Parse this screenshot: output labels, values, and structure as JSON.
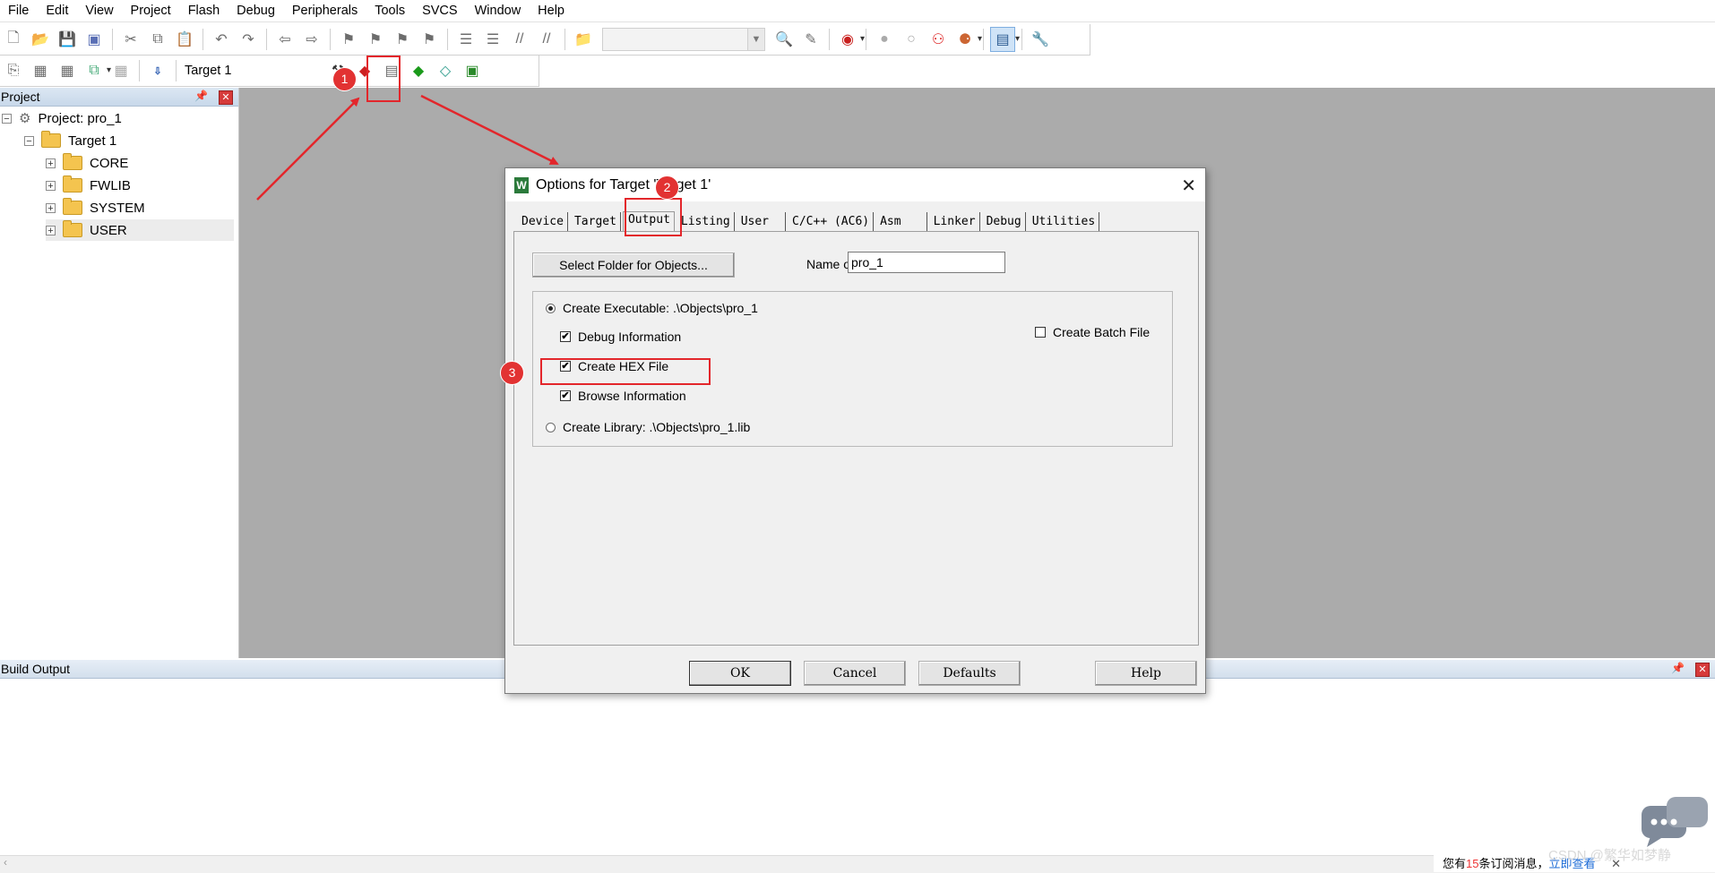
{
  "menu": [
    "File",
    "Edit",
    "View",
    "Project",
    "Flash",
    "Debug",
    "Peripherals",
    "Tools",
    "SVCS",
    "Window",
    "Help"
  ],
  "toolbar2": {
    "target": "Target 1"
  },
  "project_panel": {
    "title": "Project",
    "tree": {
      "project": "Project: pro_1",
      "target": "Target 1",
      "groups": [
        "CORE",
        "FWLIB",
        "SYSTEM",
        "USER"
      ]
    }
  },
  "build_output": {
    "title": "Build Output"
  },
  "dialog": {
    "title": "Options for Target 'Target 1'",
    "tabs": [
      "Device",
      "Target",
      "Output",
      "Listing",
      "User",
      "C/C++ (AC6)",
      "Asm",
      "Linker",
      "Debug",
      "Utilities"
    ],
    "active_tab": "Output",
    "select_folder_button": "Select Folder for Objects...",
    "exe_name_label": "Name of Executable:",
    "exe_name_value": "pro_1",
    "create_executable": "Create Executable:  .\\Objects\\pro_1",
    "debug_info": "Debug Information",
    "create_hex": "Create HEX File",
    "browse_info": "Browse Information",
    "create_library": "Create Library:  .\\Objects\\pro_1.lib",
    "create_batch": "Create Batch File",
    "buttons": {
      "ok": "OK",
      "cancel": "Cancel",
      "defaults": "Defaults",
      "help": "Help"
    }
  },
  "annotations": {
    "step1": "1",
    "step2": "2",
    "step3": "3",
    "color": "#e3262b"
  },
  "watermark": "CSDN @繁华如梦静",
  "notice": {
    "prefix": "您有",
    "count": "15",
    "suffix": "条订阅消息，",
    "link": "立即查看"
  }
}
